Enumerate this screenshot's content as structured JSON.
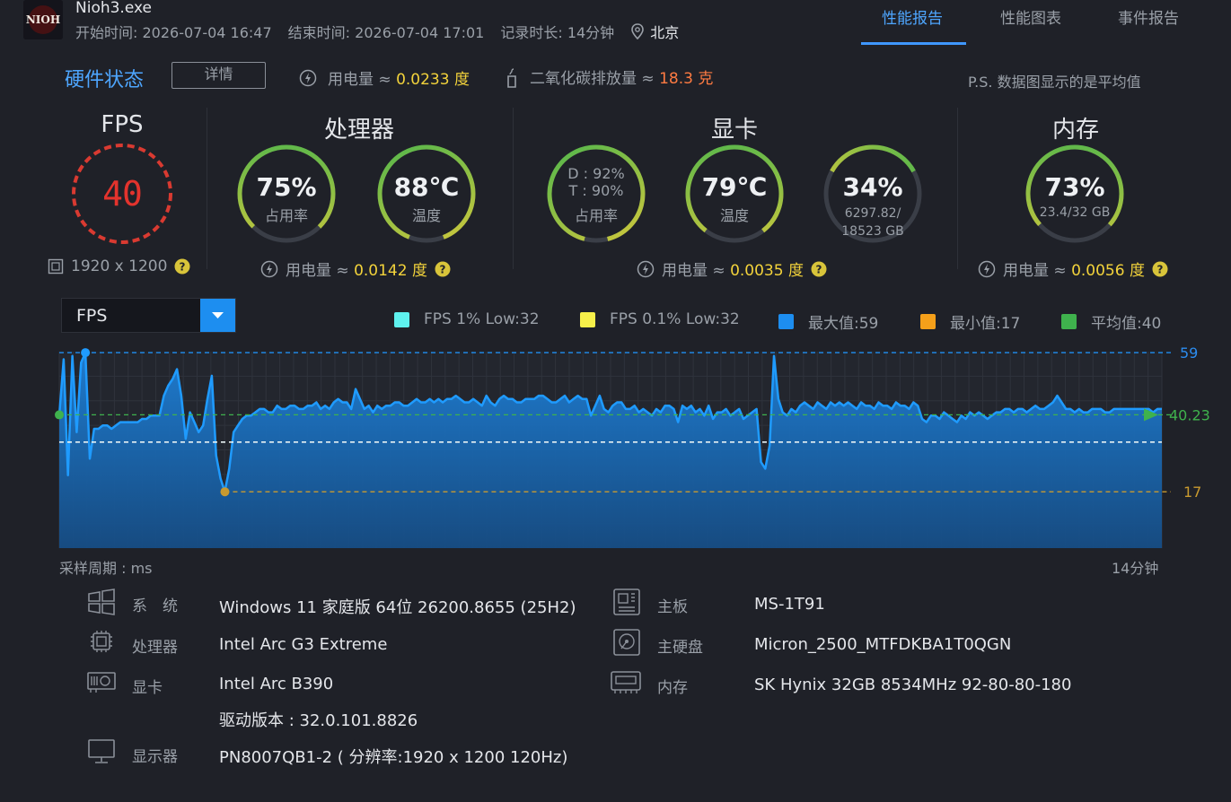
{
  "header": {
    "app_name": "Nioh3.exe",
    "app_icon_text": "NIOH",
    "start_label": "开始时间: 2026-07-04 16:47",
    "end_label": "结束时间: 2026-07-04 17:01",
    "duration_label": "记录时长: 14分钟",
    "city": "北京",
    "tabs": [
      {
        "label": "性能报告",
        "active": true
      },
      {
        "label": "性能图表",
        "active": false
      },
      {
        "label": "事件报告",
        "active": false
      }
    ]
  },
  "hardware": {
    "title": "硬件状态",
    "details_button": "详情",
    "power_label": "用电量 ≈",
    "power_value": "0.0233 度",
    "co2_label": "二氧化碳排放量 ≈",
    "co2_value": "18.3 克",
    "note": "P.S. 数据图显示的是平均值"
  },
  "sections": {
    "fps": {
      "title": "FPS",
      "value": "40",
      "resolution": "1920 x 1200"
    },
    "cpu": {
      "title": "处理器",
      "usage_value": "75%",
      "usage_label": "占用率",
      "usage_fraction": 0.75,
      "temp_value": "88℃",
      "temp_label": "温度",
      "temp_fraction": 0.88,
      "power_label": "用电量 ≈",
      "power_value": "0.0142 度"
    },
    "gpu": {
      "title": "显卡",
      "usage_d": "D : 92%",
      "usage_t": "T : 90%",
      "usage_label": "占用率",
      "usage_fraction": 0.92,
      "temp_value": "79℃",
      "temp_label": "温度",
      "temp_fraction": 0.79,
      "vram_value": "34%",
      "vram_line1": "6297.82/",
      "vram_line2": "18523 GB",
      "vram_fraction": 0.34,
      "power_label": "用电量 ≈",
      "power_value": "0.0035 度"
    },
    "memory": {
      "title": "内存",
      "usage_value": "73%",
      "usage_detail": "23.4/32 GB",
      "usage_fraction": 0.73,
      "power_label": "用电量 ≈",
      "power_value": "0.0056 度"
    }
  },
  "chart_toolbar": {
    "selected_metric": "FPS",
    "legend": [
      {
        "label": "FPS 1% Low:32",
        "color": "#5ef1ee"
      },
      {
        "label": "FPS 0.1% Low:32",
        "color": "#f7f04a"
      },
      {
        "label": "最大值:59",
        "color": "#1d8ef0"
      },
      {
        "label": "最小值:17",
        "color": "#f5a01a"
      },
      {
        "label": "平均值:40",
        "color": "#3fb24d"
      }
    ]
  },
  "chart_data": {
    "type": "area",
    "y_max_label": "59",
    "y_avg_label": "40.23",
    "y_min_label": "17",
    "x_label": "采样周期 : ms",
    "x_end_label": "14分钟",
    "max": 59,
    "min": 17,
    "avg": 40.23,
    "low_1pct": 32,
    "low_01pct": 32,
    "ylim": [
      0,
      62
    ],
    "values": [
      40,
      57,
      22,
      58,
      35,
      56,
      59,
      27,
      36,
      36,
      37,
      37,
      36,
      37,
      38,
      38,
      38,
      38,
      38,
      39,
      39,
      40,
      40,
      40,
      46,
      49,
      51,
      54,
      46,
      33,
      41,
      38,
      35,
      37,
      45,
      52,
      28,
      21,
      17,
      24,
      35,
      37,
      39,
      40,
      40,
      41,
      42,
      42,
      41,
      41,
      43,
      42,
      42,
      43,
      43,
      42,
      42,
      43,
      43,
      44,
      42,
      43,
      42,
      44,
      45,
      44,
      44,
      42,
      48,
      45,
      42,
      43,
      41,
      43,
      42,
      43,
      43,
      44,
      44,
      43,
      43,
      44,
      45,
      44,
      44,
      45,
      44,
      45,
      44,
      45,
      45,
      46,
      45,
      44,
      44,
      45,
      44,
      43,
      46,
      44,
      43,
      45,
      46,
      45,
      45,
      44,
      44,
      45,
      45,
      45,
      46,
      46,
      45,
      44,
      44,
      45,
      46,
      44,
      45,
      46,
      45,
      45,
      40,
      43,
      46,
      42,
      41,
      43,
      44,
      44,
      42,
      42,
      43,
      41,
      42,
      41,
      40,
      42,
      41,
      43,
      43,
      42,
      38,
      43,
      42,
      43,
      41,
      42,
      40,
      43,
      39,
      41,
      41,
      42,
      40,
      41,
      42,
      39,
      40,
      41,
      42,
      26,
      24,
      31,
      58,
      45,
      41,
      40,
      42,
      41,
      43,
      44,
      43,
      42,
      44,
      43,
      42,
      44,
      43,
      44,
      43,
      44,
      43,
      42,
      44,
      43,
      43,
      42,
      44,
      43,
      43,
      42,
      44,
      43,
      43,
      42,
      44,
      43,
      39,
      38,
      40,
      40,
      39,
      41,
      40,
      39,
      38,
      40,
      39,
      41,
      40,
      41,
      40,
      39,
      40,
      41,
      41,
      42,
      42,
      41,
      42,
      42,
      41,
      42,
      43,
      42,
      42,
      43,
      44,
      46,
      44,
      42,
      42,
      41,
      42,
      41,
      41,
      42,
      42,
      42,
      41,
      41,
      42,
      42,
      42,
      42,
      42,
      42,
      42,
      42,
      42,
      41,
      42,
      42
    ]
  },
  "system_info": {
    "left": [
      {
        "label": "系　统",
        "value": "Windows 11 家庭版 64位 26200.8655 (25H2)"
      },
      {
        "label": "处理器",
        "value": "Intel Arc G3 Extreme"
      },
      {
        "label": "显卡",
        "value": "Intel Arc B390",
        "extra": "驱动版本 : 32.0.101.8826"
      },
      {
        "label": "显示器",
        "value": "PN8007QB1-2 ( 分辨率:1920 x 1200 120Hz)"
      }
    ],
    "right": [
      {
        "label": "主板",
        "value": "MS-1T91"
      },
      {
        "label": "主硬盘",
        "value": "Micron_2500_MTFDKBA1T0QGN"
      },
      {
        "label": "内存",
        "value": "SK Hynix 32GB 8534MHz 92-80-80-180"
      }
    ]
  }
}
